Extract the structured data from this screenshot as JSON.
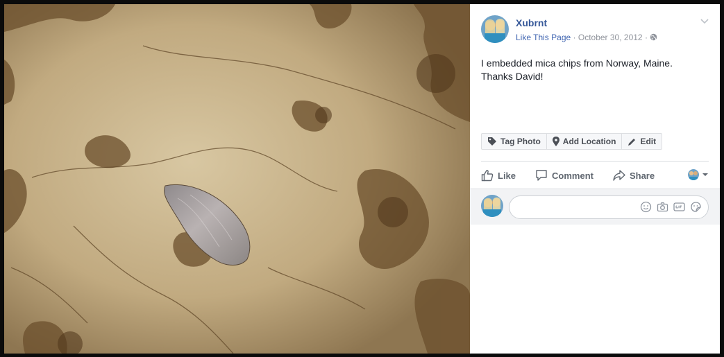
{
  "post": {
    "page_name": "Xubrnt",
    "like_page": "Like This Page",
    "separator": "·",
    "date": "October 30, 2012",
    "caption": "I embedded mica chips from Norway, Maine. Thanks David!"
  },
  "photo_actions": {
    "tag": "Tag Photo",
    "location": "Add Location",
    "edit": "Edit"
  },
  "ufi": {
    "like": "Like",
    "comment": "Comment",
    "share": "Share"
  },
  "comment_box": {
    "placeholder": ""
  },
  "colors": {
    "link": "#365899",
    "meta": "#90949c",
    "action_text": "#606770",
    "stone_base": "#b59e76"
  },
  "icons": [
    "chevron-down-icon",
    "globe-icon",
    "tag-icon",
    "location-pin-icon",
    "pencil-icon",
    "thumbs-up-icon",
    "comment-icon",
    "share-icon",
    "smiley-icon",
    "camera-icon",
    "gif-icon",
    "sticker-icon"
  ]
}
